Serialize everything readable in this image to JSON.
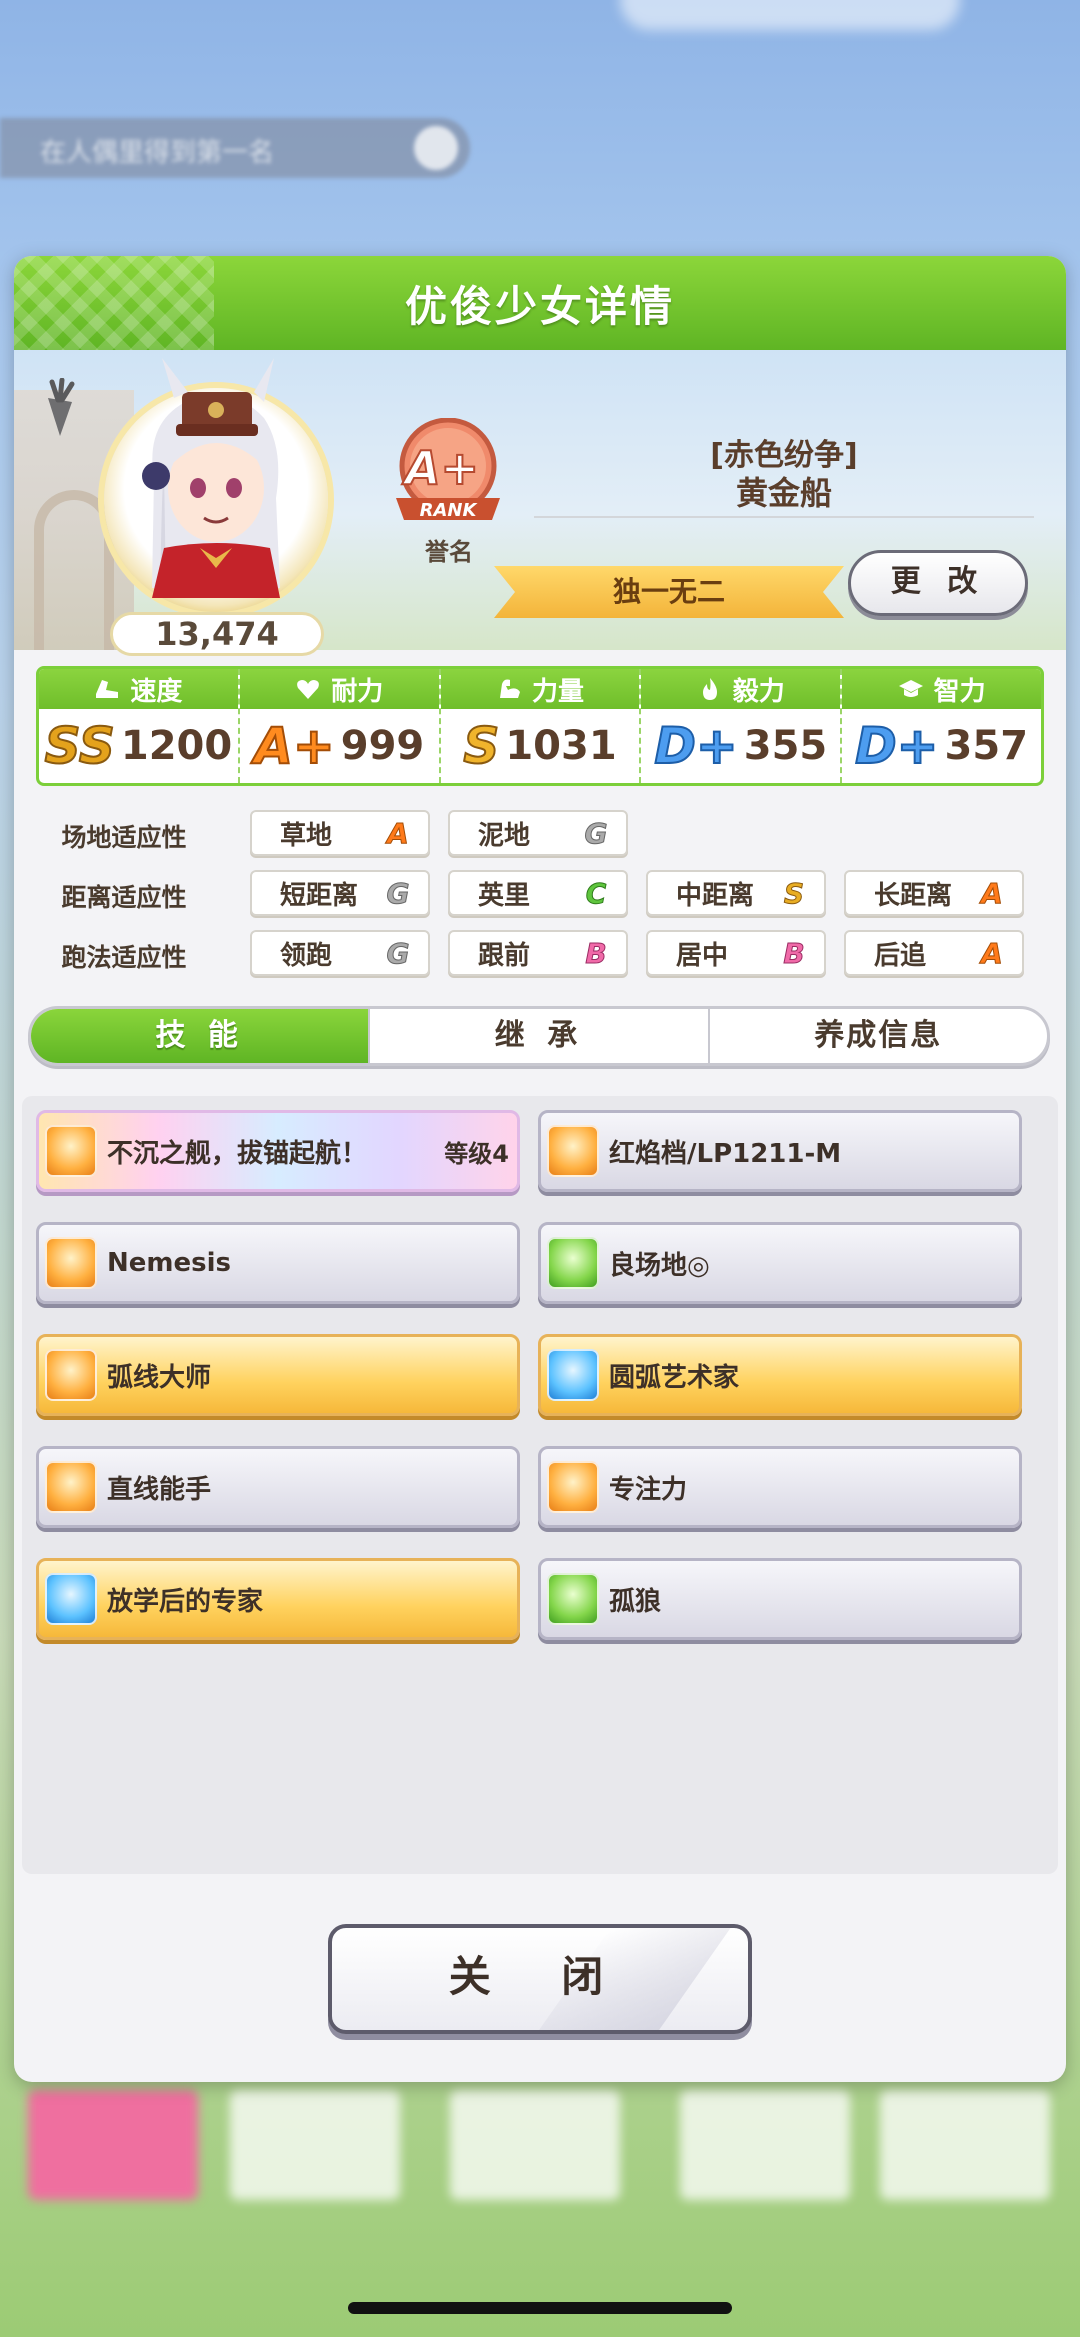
{
  "background": {
    "toast_text": "在人偶里得到第一名",
    "nav_tiles": 5
  },
  "header": {
    "title": "优俊少女详情"
  },
  "profile": {
    "score": "13,474",
    "rank_badge": "A+",
    "rank_badge_sub": "RANK",
    "rank_name": "誉名",
    "epithet": "[赤色纷争]",
    "name": "黄金船",
    "title": "独一无二",
    "change_button": "更 改"
  },
  "stats": [
    {
      "label": "速度",
      "icon": "shoe-icon",
      "grade": "SS",
      "value": "1200"
    },
    {
      "label": "耐力",
      "icon": "heart-icon",
      "grade": "A+",
      "value": "999"
    },
    {
      "label": "力量",
      "icon": "muscle-icon",
      "grade": "S",
      "value": "1031"
    },
    {
      "label": "毅力",
      "icon": "flame-icon",
      "grade": "D+",
      "value": "355"
    },
    {
      "label": "智力",
      "icon": "graduation-cap-icon",
      "grade": "D+",
      "value": "357"
    }
  ],
  "aptitude": {
    "track": {
      "label": "场地适应性",
      "items": [
        {
          "name": "草地",
          "grade": "A"
        },
        {
          "name": "泥地",
          "grade": "G"
        }
      ]
    },
    "distance": {
      "label": "距离适应性",
      "items": [
        {
          "name": "短距离",
          "grade": "G"
        },
        {
          "name": "英里",
          "grade": "C"
        },
        {
          "name": "中距离",
          "grade": "S"
        },
        {
          "name": "长距离",
          "grade": "A"
        }
      ]
    },
    "style": {
      "label": "跑法适应性",
      "items": [
        {
          "name": "领跑",
          "grade": "G"
        },
        {
          "name": "跟前",
          "grade": "B"
        },
        {
          "name": "居中",
          "grade": "B"
        },
        {
          "name": "后追",
          "grade": "A"
        }
      ]
    }
  },
  "tabs": [
    "技 能",
    "继 承",
    "养成信息"
  ],
  "skills": [
    {
      "name": "不沉之舰，拔锚起航！",
      "level": "等级4",
      "style": "rainbow",
      "icon": "orange"
    },
    {
      "name": "红焰档/LP1211-M",
      "style": "normal",
      "icon": "orange"
    },
    {
      "name": "Nemesis",
      "style": "normal",
      "icon": "orange"
    },
    {
      "name": "良场地◎",
      "style": "normal",
      "icon": "green"
    },
    {
      "name": "弧线大师",
      "style": "gold",
      "icon": "orange"
    },
    {
      "name": "圆弧艺术家",
      "style": "gold",
      "icon": "blue"
    },
    {
      "name": "直线能手",
      "style": "normal",
      "icon": "orange"
    },
    {
      "name": "专注力",
      "style": "normal",
      "icon": "orange"
    },
    {
      "name": "放学后的专家",
      "style": "gold",
      "icon": "blue"
    },
    {
      "name": "孤狼",
      "style": "normal",
      "icon": "green"
    }
  ],
  "close_button": "关 闭",
  "colors": {
    "header_green": "#6fbe2a",
    "title_gold": "#f3b43a",
    "text_brown": "#5a3e2b"
  }
}
